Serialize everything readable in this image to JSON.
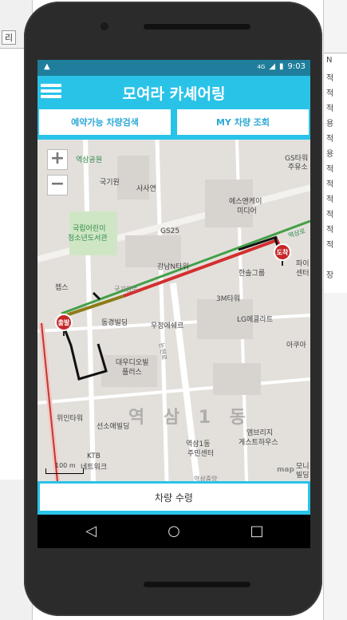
{
  "desktop_left": {
    "labels": [
      "리"
    ]
  },
  "desktop_right": {
    "rows": [
      "N",
      "적",
      "적",
      "적",
      "용",
      "적",
      "용",
      "적",
      "적",
      "적",
      "적",
      "적",
      "적",
      "장"
    ]
  },
  "status": {
    "time": "9:03",
    "network": "4G"
  },
  "app": {
    "title": "모여라 카셰어링"
  },
  "tabs": {
    "search": "예약가능 차량검색",
    "mycar": "MY 차량 조회"
  },
  "map": {
    "zoom_in": "+",
    "zoom_out": "−",
    "labels": {
      "yeoksam_park": "역삼공원",
      "gukgiwon": "국기원",
      "sasayeon": "사사연",
      "gs_tower": "GS타워",
      "gs_tower_sub": "주유소",
      "snk": "에스앤케이",
      "snk2": "미디어",
      "library": "국립어린이",
      "library2": "청소년도서관",
      "gs25": "GS25",
      "gangnam_n": "강남N타워",
      "hanseung": "한솔그룹",
      "peace": "파이",
      "center": "센터",
      "zeps": "젭스",
      "gukgiwon_ro": "국기원로",
      "tm3": "3M타워",
      "dongkyung": "동경빌딩",
      "woojung": "우정에쉐르",
      "lg": "LG에클라트",
      "aqua": "아쿠아",
      "daewoo": "대우디오빌",
      "daewoo2": "플러스",
      "nonhyeon": "논현로",
      "inan": "위인타워",
      "seonsoe": "선소애빌딩",
      "yeoksam_center": "역삼1동",
      "yeoksam_center2": "주민센터",
      "embridge": "엠브리지",
      "embridge2": "게스트하우스",
      "ktb": "KTB",
      "ktb2": "네트워크",
      "yeoksam_big": "역 삼 1 동",
      "monet": "모니",
      "monet2": "빌딩",
      "yeoksam_ro": "역삼로",
      "skmap": "map",
      "scale": "100 m",
      "station": "역삼중앙"
    },
    "start_marker": "출발",
    "end_marker": "도착",
    "route_colors": {
      "red": "#d32f2f",
      "green": "#43a047",
      "olive": "#8d7b17",
      "black": "#111111"
    }
  },
  "bottom": {
    "rent_button": "차량 수령"
  },
  "nav": {
    "back": "◁",
    "home": "○",
    "recent": "□"
  }
}
